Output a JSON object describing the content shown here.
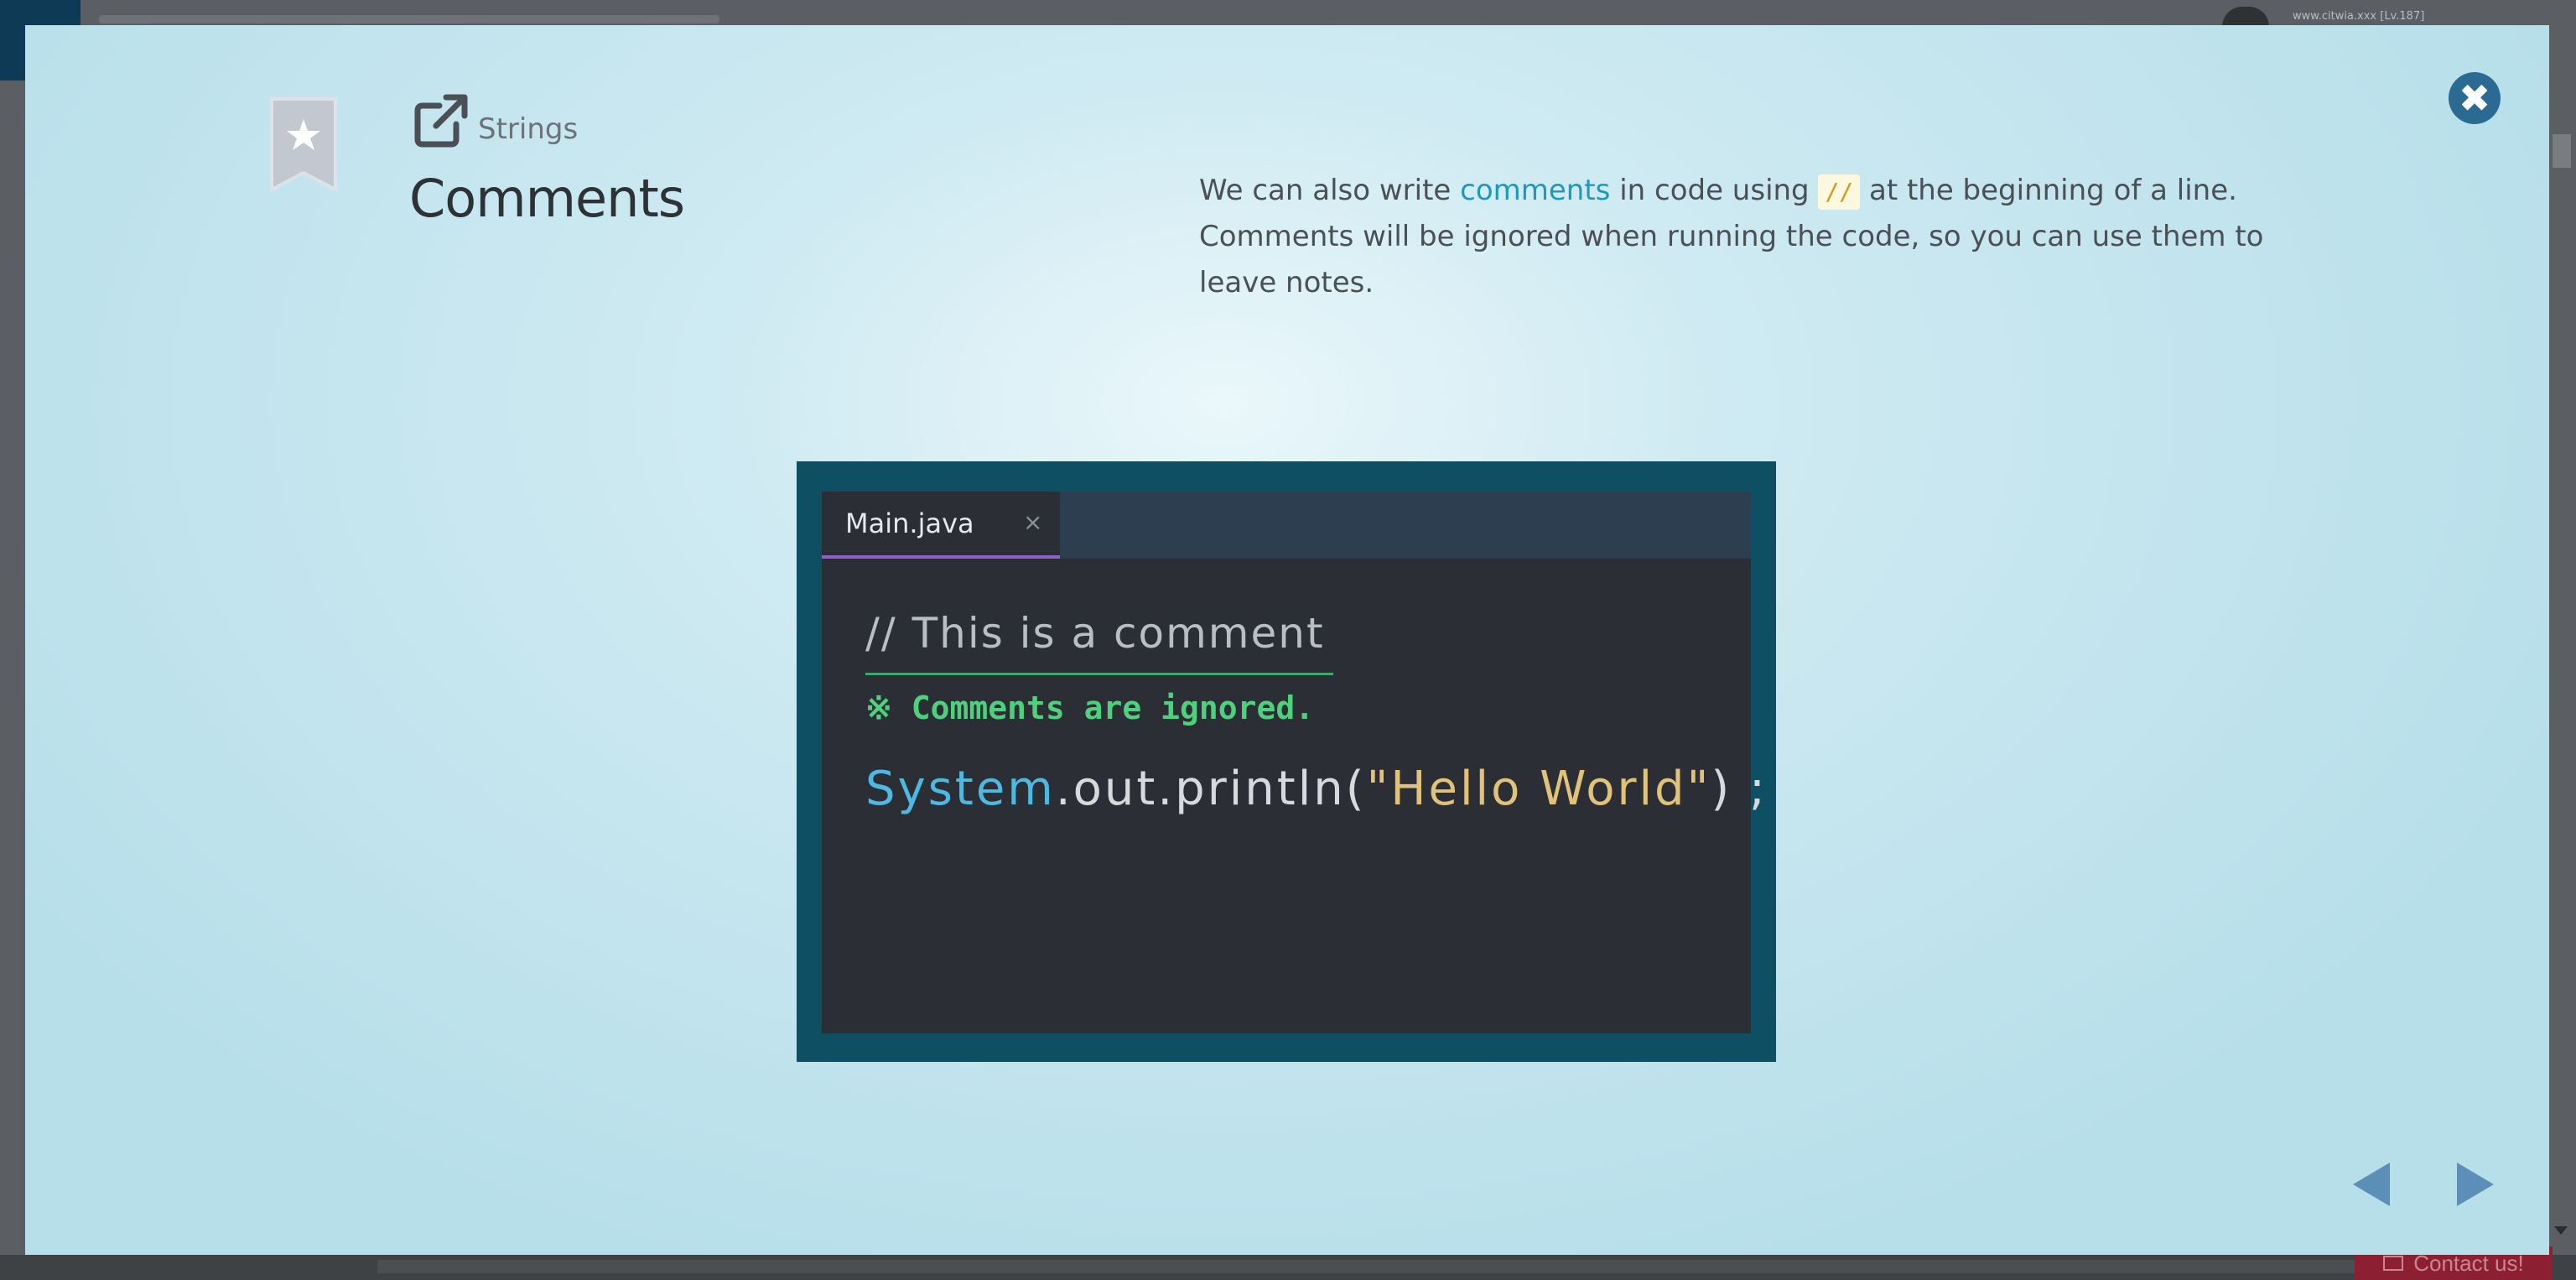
{
  "background": {
    "user_text": "www.citwia.xxx [Lv.187]",
    "contact_label": "Contact us!"
  },
  "modal": {
    "category": "Strings",
    "title": "Comments",
    "description": {
      "part1": "We can also write ",
      "link": "comments",
      "part2": " in code using ",
      "code": "//",
      "part3": " at the beginning of a line. Comments will be ignored when running the code, so you can use them to leave notes."
    },
    "close_icon": "close-icon",
    "bookmark_icon": "bookmark-star-icon",
    "external_icon": "external-link-icon"
  },
  "figure": {
    "tab_label": "Main.java",
    "tab_close": "×",
    "comment": "// This is a comment",
    "note": "※ Comments are ignored.",
    "code_class": "System",
    "code_mid": ".out.println(",
    "code_string": "\"Hello World\"",
    "code_end": ") ;"
  },
  "colors": {
    "accent": "#2b6b93",
    "link": "#1a9ac0",
    "editor_bg": "#2b2e35",
    "frame_bg": "#0f4f63",
    "comment_note": "#4fd07c"
  }
}
